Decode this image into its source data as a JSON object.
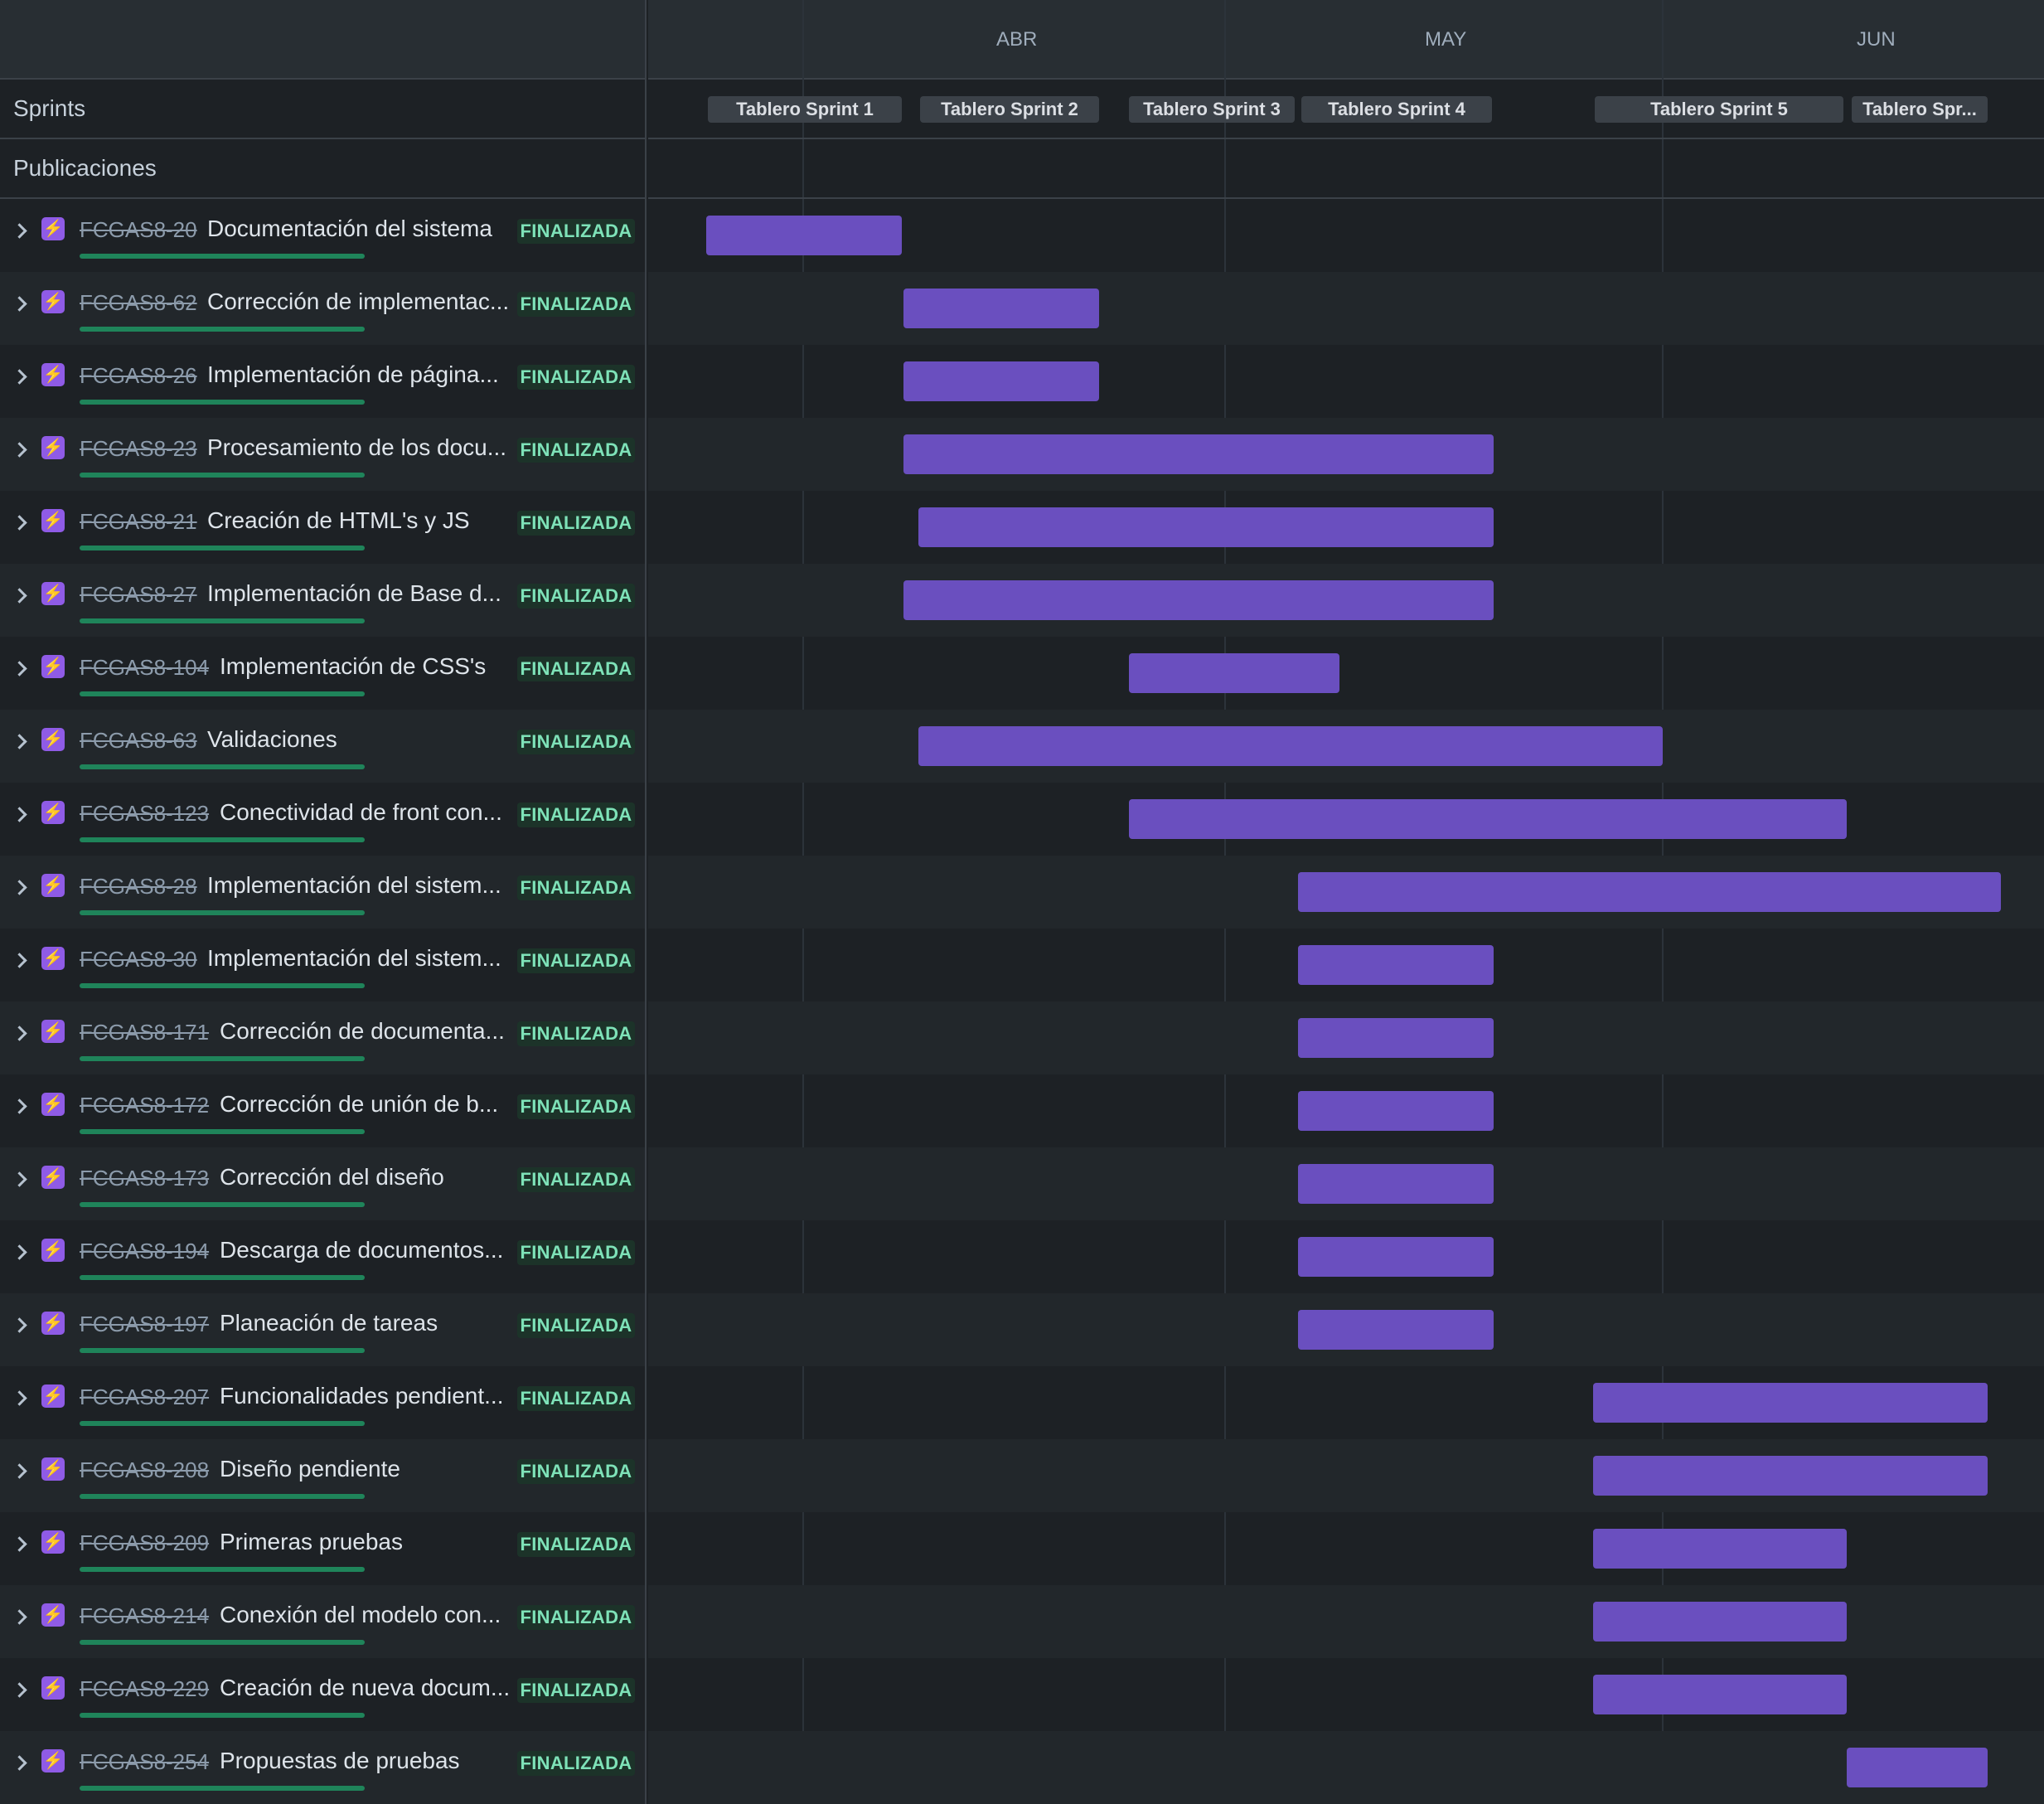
{
  "months": [
    "ABR",
    "MAY",
    "JUN"
  ],
  "labels": {
    "sprints": "Sprints",
    "publicaciones": "Publicaciones"
  },
  "sprints": [
    "Tablero Sprint 1",
    "Tablero Sprint 2",
    "Tablero Sprint 3",
    "Tablero Sprint 4",
    "Tablero Sprint 5",
    "Tablero Spr..."
  ],
  "issues": [
    {
      "key": "FCGAS8-20",
      "title": "Documentación del sistema",
      "status": "FINALIZADA"
    },
    {
      "key": "FCGAS8-62",
      "title": "Corrección de implementac...",
      "status": "FINALIZADA"
    },
    {
      "key": "FCGAS8-26",
      "title": "Implementación de página...",
      "status": "FINALIZADA"
    },
    {
      "key": "FCGAS8-23",
      "title": "Procesamiento de los docu...",
      "status": "FINALIZADA"
    },
    {
      "key": "FCGAS8-21",
      "title": "Creación de HTML's y JS",
      "status": "FINALIZADA"
    },
    {
      "key": "FCGAS8-27",
      "title": "Implementación de Base d...",
      "status": "FINALIZADA"
    },
    {
      "key": "FCGAS8-104",
      "title": "Implementación de CSS's",
      "status": "FINALIZADA"
    },
    {
      "key": "FCGAS8-63",
      "title": "Validaciones",
      "status": "FINALIZADA"
    },
    {
      "key": "FCGAS8-123",
      "title": "Conectividad de front con...",
      "status": "FINALIZADA"
    },
    {
      "key": "FCGAS8-28",
      "title": "Implementación del sistem...",
      "status": "FINALIZADA"
    },
    {
      "key": "FCGAS8-30",
      "title": "Implementación del sistem...",
      "status": "FINALIZADA"
    },
    {
      "key": "FCGAS8-171",
      "title": "Corrección de documenta...",
      "status": "FINALIZADA"
    },
    {
      "key": "FCGAS8-172",
      "title": "Corrección de unión de b...",
      "status": "FINALIZADA"
    },
    {
      "key": "FCGAS8-173",
      "title": "Corrección del diseño",
      "status": "FINALIZADA"
    },
    {
      "key": "FCGAS8-194",
      "title": "Descarga de documentos...",
      "status": "FINALIZADA"
    },
    {
      "key": "FCGAS8-197",
      "title": "Planeación de tareas",
      "status": "FINALIZADA"
    },
    {
      "key": "FCGAS8-207",
      "title": "Funcionalidades pendient...",
      "status": "FINALIZADA"
    },
    {
      "key": "FCGAS8-208",
      "title": "Diseño pendiente",
      "status": "FINALIZADA"
    },
    {
      "key": "FCGAS8-209",
      "title": "Primeras pruebas",
      "status": "FINALIZADA"
    },
    {
      "key": "FCGAS8-214",
      "title": "Conexión del modelo con...",
      "status": "FINALIZADA"
    },
    {
      "key": "FCGAS8-229",
      "title": "Creación de nueva docum...",
      "status": "FINALIZADA"
    },
    {
      "key": "FCGAS8-254",
      "title": "Propuestas de pruebas",
      "status": "FINALIZADA"
    }
  ],
  "icons": {
    "expand": "chevron-right-icon",
    "issue_type": "epic-lightning-icon"
  },
  "colors": {
    "bar": "#6a4fbf",
    "status_text": "#7ee2b8",
    "progress": "#1f845a",
    "epic": "#8f5be6"
  }
}
